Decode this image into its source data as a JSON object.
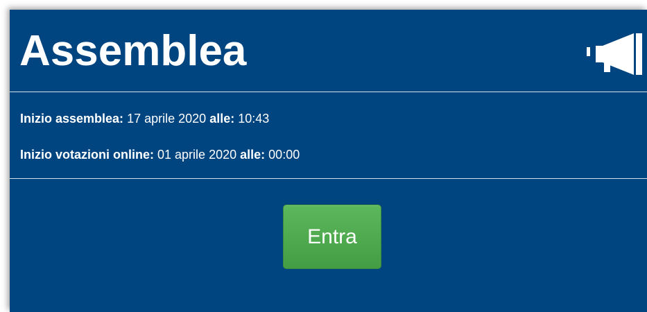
{
  "header": {
    "title": "Assemblea",
    "icon": "megaphone-icon"
  },
  "info": {
    "assembly_start_label": "Inizio assemblea:",
    "assembly_start_date": "17 aprile 2020",
    "assembly_start_time_label": "alle:",
    "assembly_start_time": "10:43",
    "voting_start_label": "Inizio votazioni online:",
    "voting_start_date": "01 aprile 2020",
    "voting_start_time_label": "alle:",
    "voting_start_time": "00:00"
  },
  "actions": {
    "enter_label": "Entra"
  },
  "colors": {
    "panel_background": "#004480",
    "button_green": "#5cb85c",
    "text": "#ffffff"
  }
}
